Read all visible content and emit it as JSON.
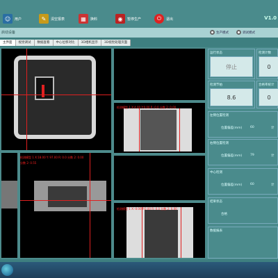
{
  "toolbar": {
    "buttons": [
      {
        "label": "用户",
        "icon": "user-icon"
      },
      {
        "label": "清空报表",
        "icon": "broom-icon"
      },
      {
        "label": "换料",
        "icon": "calendar-icon"
      },
      {
        "label": "暂停生产",
        "icon": "camera-icon"
      },
      {
        "label": "退出",
        "icon": "power-icon"
      }
    ],
    "version": "V1.0"
  },
  "status": {
    "text": "启动设备",
    "radios": [
      "生产模式",
      "调试模式"
    ]
  },
  "tabs": [
    "主界面",
    "视觉调试",
    "数据查看",
    "中心位移对比",
    "3D相机显示",
    "3D视觉处理页面"
  ],
  "overlays": {
    "top_center": "检测模型 1  X:4.00 Y:0.00 R:-0.0 分数 2: 0.00",
    "left_mid": "检测模型 1  X:18.00 Y: 97.00 R: 0.0 分数 2: 0.00",
    "left_mid2": "分数 2: 0.55",
    "bottom_center": "检测模型 1  X:-0.00 Y:0.00 R:-0.0 分数 2: 0.00"
  },
  "right": {
    "run_state_label": "运行状态",
    "run_state_value": "停止",
    "count_label": "检测计数",
    "count_value": "0",
    "cycle_label": "检测节拍",
    "cycle_value": "8.6",
    "yield_label": "合格率统计",
    "yield_value": "0",
    "sections": [
      {
        "title": "左侧位置检测",
        "row": "位置偏差(mm)",
        "value": "60",
        "unit": "计"
      },
      {
        "title": "右侧位置检测",
        "row": "位置偏差(mm)",
        "value": "79",
        "unit": "计"
      },
      {
        "title": "中心检测",
        "row": "位置偏差(mm)",
        "value": "60",
        "unit": "计"
      },
      {
        "title": "结果状态",
        "row": "合格",
        "value": "",
        "unit": ""
      },
      {
        "title": "数据报表",
        "row": "",
        "value": "",
        "unit": ""
      }
    ]
  }
}
